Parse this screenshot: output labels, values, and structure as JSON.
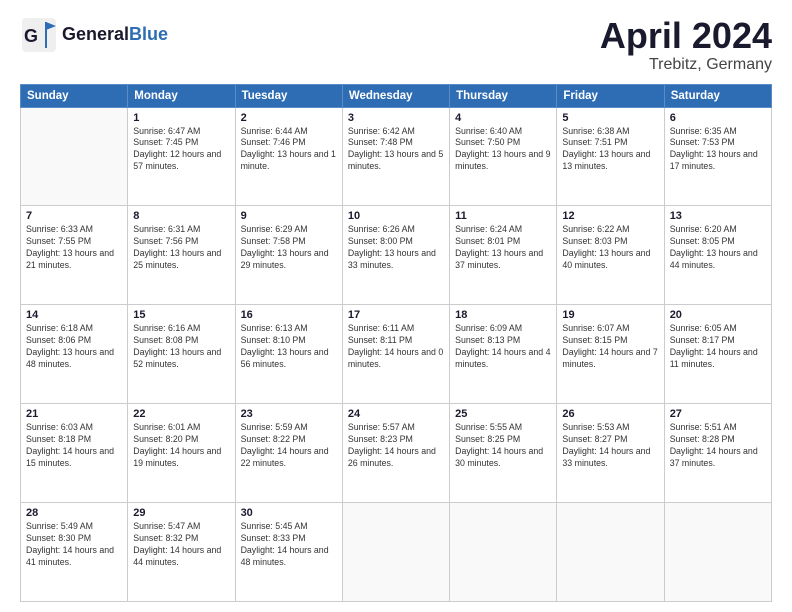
{
  "header": {
    "logo_line1": "General",
    "logo_line2": "Blue",
    "title": "April 2024",
    "subtitle": "Trebitz, Germany"
  },
  "days_of_week": [
    "Sunday",
    "Monday",
    "Tuesday",
    "Wednesday",
    "Thursday",
    "Friday",
    "Saturday"
  ],
  "weeks": [
    [
      {
        "day": "",
        "sunrise": "",
        "sunset": "",
        "daylight": ""
      },
      {
        "day": "1",
        "sunrise": "Sunrise: 6:47 AM",
        "sunset": "Sunset: 7:45 PM",
        "daylight": "Daylight: 12 hours and 57 minutes."
      },
      {
        "day": "2",
        "sunrise": "Sunrise: 6:44 AM",
        "sunset": "Sunset: 7:46 PM",
        "daylight": "Daylight: 13 hours and 1 minute."
      },
      {
        "day": "3",
        "sunrise": "Sunrise: 6:42 AM",
        "sunset": "Sunset: 7:48 PM",
        "daylight": "Daylight: 13 hours and 5 minutes."
      },
      {
        "day": "4",
        "sunrise": "Sunrise: 6:40 AM",
        "sunset": "Sunset: 7:50 PM",
        "daylight": "Daylight: 13 hours and 9 minutes."
      },
      {
        "day": "5",
        "sunrise": "Sunrise: 6:38 AM",
        "sunset": "Sunset: 7:51 PM",
        "daylight": "Daylight: 13 hours and 13 minutes."
      },
      {
        "day": "6",
        "sunrise": "Sunrise: 6:35 AM",
        "sunset": "Sunset: 7:53 PM",
        "daylight": "Daylight: 13 hours and 17 minutes."
      }
    ],
    [
      {
        "day": "7",
        "sunrise": "Sunrise: 6:33 AM",
        "sunset": "Sunset: 7:55 PM",
        "daylight": "Daylight: 13 hours and 21 minutes."
      },
      {
        "day": "8",
        "sunrise": "Sunrise: 6:31 AM",
        "sunset": "Sunset: 7:56 PM",
        "daylight": "Daylight: 13 hours and 25 minutes."
      },
      {
        "day": "9",
        "sunrise": "Sunrise: 6:29 AM",
        "sunset": "Sunset: 7:58 PM",
        "daylight": "Daylight: 13 hours and 29 minutes."
      },
      {
        "day": "10",
        "sunrise": "Sunrise: 6:26 AM",
        "sunset": "Sunset: 8:00 PM",
        "daylight": "Daylight: 13 hours and 33 minutes."
      },
      {
        "day": "11",
        "sunrise": "Sunrise: 6:24 AM",
        "sunset": "Sunset: 8:01 PM",
        "daylight": "Daylight: 13 hours and 37 minutes."
      },
      {
        "day": "12",
        "sunrise": "Sunrise: 6:22 AM",
        "sunset": "Sunset: 8:03 PM",
        "daylight": "Daylight: 13 hours and 40 minutes."
      },
      {
        "day": "13",
        "sunrise": "Sunrise: 6:20 AM",
        "sunset": "Sunset: 8:05 PM",
        "daylight": "Daylight: 13 hours and 44 minutes."
      }
    ],
    [
      {
        "day": "14",
        "sunrise": "Sunrise: 6:18 AM",
        "sunset": "Sunset: 8:06 PM",
        "daylight": "Daylight: 13 hours and 48 minutes."
      },
      {
        "day": "15",
        "sunrise": "Sunrise: 6:16 AM",
        "sunset": "Sunset: 8:08 PM",
        "daylight": "Daylight: 13 hours and 52 minutes."
      },
      {
        "day": "16",
        "sunrise": "Sunrise: 6:13 AM",
        "sunset": "Sunset: 8:10 PM",
        "daylight": "Daylight: 13 hours and 56 minutes."
      },
      {
        "day": "17",
        "sunrise": "Sunrise: 6:11 AM",
        "sunset": "Sunset: 8:11 PM",
        "daylight": "Daylight: 14 hours and 0 minutes."
      },
      {
        "day": "18",
        "sunrise": "Sunrise: 6:09 AM",
        "sunset": "Sunset: 8:13 PM",
        "daylight": "Daylight: 14 hours and 4 minutes."
      },
      {
        "day": "19",
        "sunrise": "Sunrise: 6:07 AM",
        "sunset": "Sunset: 8:15 PM",
        "daylight": "Daylight: 14 hours and 7 minutes."
      },
      {
        "day": "20",
        "sunrise": "Sunrise: 6:05 AM",
        "sunset": "Sunset: 8:17 PM",
        "daylight": "Daylight: 14 hours and 11 minutes."
      }
    ],
    [
      {
        "day": "21",
        "sunrise": "Sunrise: 6:03 AM",
        "sunset": "Sunset: 8:18 PM",
        "daylight": "Daylight: 14 hours and 15 minutes."
      },
      {
        "day": "22",
        "sunrise": "Sunrise: 6:01 AM",
        "sunset": "Sunset: 8:20 PM",
        "daylight": "Daylight: 14 hours and 19 minutes."
      },
      {
        "day": "23",
        "sunrise": "Sunrise: 5:59 AM",
        "sunset": "Sunset: 8:22 PM",
        "daylight": "Daylight: 14 hours and 22 minutes."
      },
      {
        "day": "24",
        "sunrise": "Sunrise: 5:57 AM",
        "sunset": "Sunset: 8:23 PM",
        "daylight": "Daylight: 14 hours and 26 minutes."
      },
      {
        "day": "25",
        "sunrise": "Sunrise: 5:55 AM",
        "sunset": "Sunset: 8:25 PM",
        "daylight": "Daylight: 14 hours and 30 minutes."
      },
      {
        "day": "26",
        "sunrise": "Sunrise: 5:53 AM",
        "sunset": "Sunset: 8:27 PM",
        "daylight": "Daylight: 14 hours and 33 minutes."
      },
      {
        "day": "27",
        "sunrise": "Sunrise: 5:51 AM",
        "sunset": "Sunset: 8:28 PM",
        "daylight": "Daylight: 14 hours and 37 minutes."
      }
    ],
    [
      {
        "day": "28",
        "sunrise": "Sunrise: 5:49 AM",
        "sunset": "Sunset: 8:30 PM",
        "daylight": "Daylight: 14 hours and 41 minutes."
      },
      {
        "day": "29",
        "sunrise": "Sunrise: 5:47 AM",
        "sunset": "Sunset: 8:32 PM",
        "daylight": "Daylight: 14 hours and 44 minutes."
      },
      {
        "day": "30",
        "sunrise": "Sunrise: 5:45 AM",
        "sunset": "Sunset: 8:33 PM",
        "daylight": "Daylight: 14 hours and 48 minutes."
      },
      {
        "day": "",
        "sunrise": "",
        "sunset": "",
        "daylight": ""
      },
      {
        "day": "",
        "sunrise": "",
        "sunset": "",
        "daylight": ""
      },
      {
        "day": "",
        "sunrise": "",
        "sunset": "",
        "daylight": ""
      },
      {
        "day": "",
        "sunrise": "",
        "sunset": "",
        "daylight": ""
      }
    ]
  ]
}
